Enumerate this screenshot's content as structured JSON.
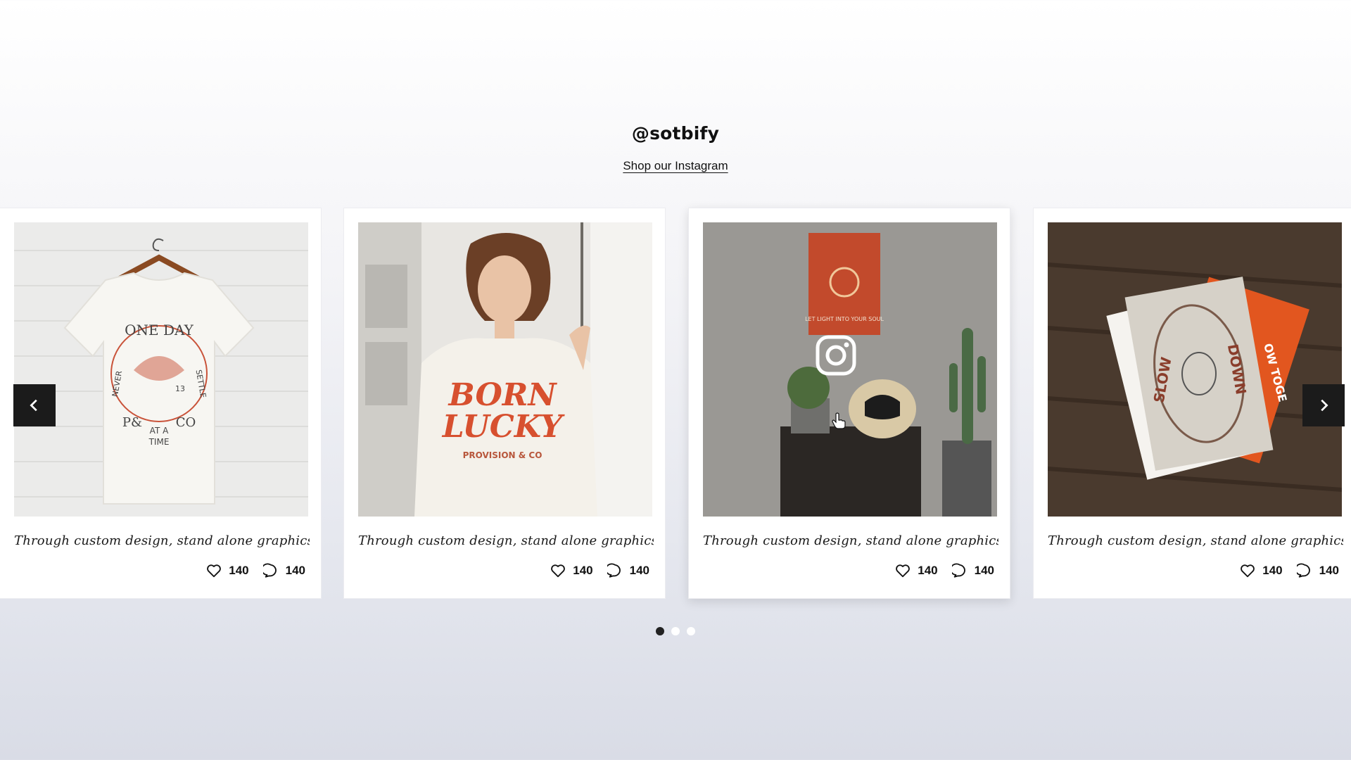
{
  "header": {
    "handle": "@sotbify",
    "shop_link": "Shop our Instagram"
  },
  "posts": [
    {
      "caption": "Through custom design, stand alone graphics & q...",
      "likes": "140",
      "comments": "140",
      "print": [
        "ONE DAY",
        "NEVER",
        "SETTLE",
        "P&",
        "CO",
        "AT A",
        "TIME",
        "13"
      ]
    },
    {
      "caption": "Through custom design, stand alone graphics & q...",
      "likes": "140",
      "comments": "140",
      "print": [
        "BORN",
        "LUCKY",
        "PROVISION & CO"
      ]
    },
    {
      "caption": "Through custom design, stand alone graphics & q...",
      "likes": "140",
      "comments": "140",
      "print": [
        "LET LIGHT INTO YOUR SOUL"
      ]
    },
    {
      "caption": "Through custom design, stand alone graphics & q...",
      "likes": "140",
      "comments": "140",
      "print": [
        "SLOW",
        "DOWN",
        "OW TOGE"
      ]
    }
  ],
  "icons": {
    "prev": "chevron-left-icon",
    "next": "chevron-right-icon",
    "like": "heart-icon",
    "comment": "comment-icon",
    "instagram": "instagram-icon"
  },
  "pagination": {
    "count": 3,
    "active": 1
  },
  "colors": {
    "nav": "#1b1b1b",
    "accent": "#d7502f"
  }
}
